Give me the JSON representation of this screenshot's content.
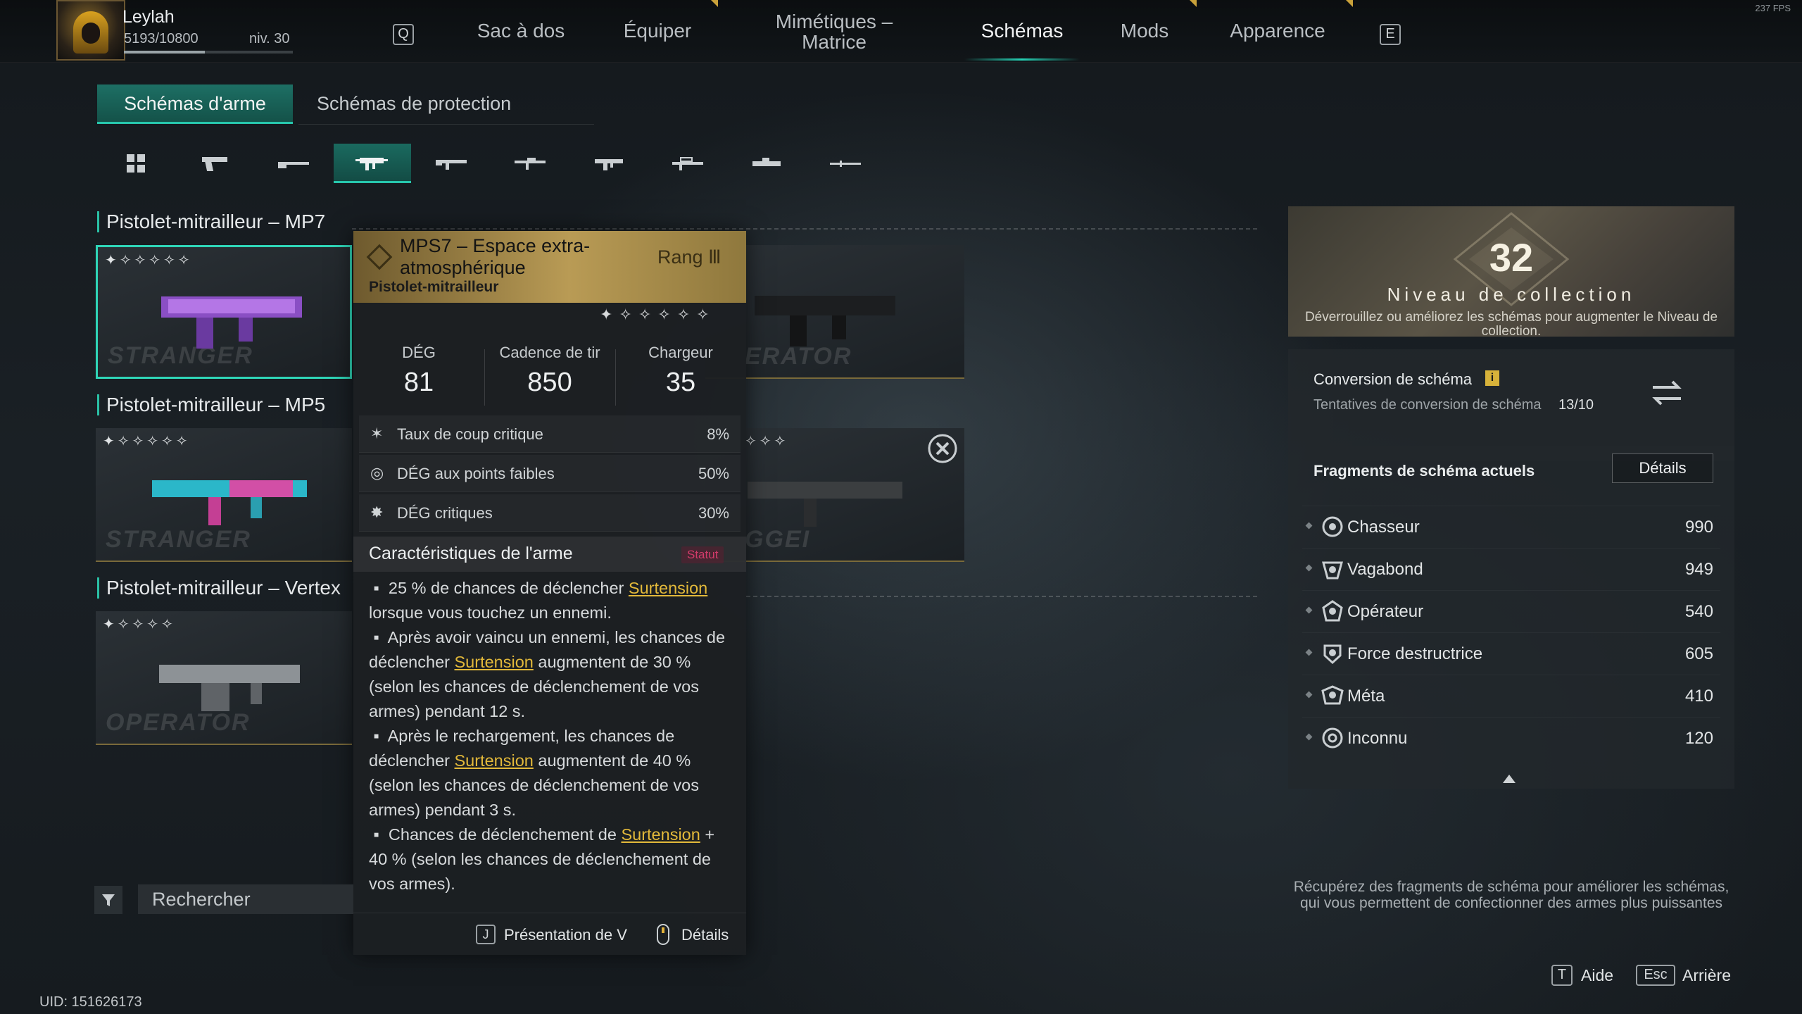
{
  "fps": "237 FPS",
  "player": {
    "name": "Leylah",
    "xp": "5193/10800",
    "xp_fraction": 0.48,
    "level": "niv. 30"
  },
  "nav": {
    "key_left": "Q",
    "key_right": "E",
    "tabs": [
      "Sac à dos",
      "Équiper",
      "Mimétiques –\nMatrice",
      "Schémas",
      "Mods",
      "Apparence"
    ],
    "active_tab": "Schémas"
  },
  "subtabs": {
    "weapon": "Schémas d'arme",
    "protection": "Schémas de protection"
  },
  "weapon_types": [
    "all-icon",
    "pistol-icon",
    "shotgun-icon",
    "smg-icon",
    "assault-rifle-icon",
    "battle-rifle-icon",
    "lmg-icon",
    "sniper-icon",
    "crossbow-icon",
    "melee-icon"
  ],
  "sections": [
    {
      "title": "Pistolet-mitrailleur – MP7",
      "cards": [
        {
          "stars": "✦✧✧✧✧✧",
          "label": "STRANGER"
        },
        {
          "stars": "",
          "label": "ERATOR"
        }
      ]
    },
    {
      "title": "Pistolet-mitrailleur – MP5",
      "cards": [
        {
          "stars": "✦✧✧✧✧✧",
          "label": "STRANGER"
        },
        {
          "stars": "✧✧✧",
          "label": "GGEI"
        }
      ]
    },
    {
      "title": "Pistolet-mitrailleur – Vertex",
      "cards": [
        {
          "stars": "✦✧✧✧✧",
          "label": "OPERATOR"
        }
      ]
    }
  ],
  "tooltip": {
    "title": "MPS7 – Espace extra-atmosphérique",
    "type": "Pistolet-mitrailleur",
    "rank": "Rang Ⅲ",
    "stars": "✦✧✧✧✧✧",
    "stats": [
      {
        "label": "DÉG",
        "value": "81"
      },
      {
        "label": "Cadence de tir",
        "value": "850"
      },
      {
        "label": "Chargeur",
        "value": "35"
      }
    ],
    "props": [
      {
        "icon": "crit-rate-icon",
        "name": "Taux de coup critique",
        "value": "8%"
      },
      {
        "icon": "weakspot-icon",
        "name": "DÉG aux points faibles",
        "value": "50%"
      },
      {
        "icon": "crit-damage-icon",
        "name": "DÉG critiques",
        "value": "30%"
      }
    ],
    "features_title": "Caractéristiques de l'arme",
    "features_badge": "Statut",
    "features": [
      {
        "pre": "25 % de chances de déclencher ",
        "link": "Surtension",
        "post": " lorsque vous touchez un ennemi."
      },
      {
        "pre": "Après avoir vaincu un ennemi, les chances de déclencher ",
        "link": "Surtension",
        "post": " augmentent de 30 % (selon les chances de déclenchement de vos armes) pendant 12 s."
      },
      {
        "pre": "Après le rechargement, les chances de déclencher ",
        "link": "Surtension",
        "post": " augmentent de 40 % (selon les chances de déclenchement de vos armes) pendant 3 s."
      },
      {
        "pre": "Chances de déclenchement de ",
        "link": "Surtension",
        "post": " + 40 % (selon les chances de déclenchement de vos armes)."
      }
    ],
    "footer": {
      "key_j": "J",
      "presentation": "Présentation de V",
      "details": "Détails"
    }
  },
  "search": {
    "placeholder": "Rechercher"
  },
  "uid": "UID: 151626173",
  "collection": {
    "level": "32",
    "label": "Niveau de collection",
    "desc": "Déverrouillez ou améliorez les schémas pour augmenter le Niveau de collection."
  },
  "conversion": {
    "title": "Conversion de schéma",
    "info": "i",
    "attempts_label": "Tentatives de conversion de schéma",
    "attempts": "13/10"
  },
  "fragments": {
    "title": "Fragments de schéma actuels",
    "details": "Détails",
    "items": [
      {
        "name": "Chasseur",
        "value": "990"
      },
      {
        "name": "Vagabond",
        "value": "949"
      },
      {
        "name": "Opérateur",
        "value": "540"
      },
      {
        "name": "Force destructrice",
        "value": "605"
      },
      {
        "name": "Méta",
        "value": "410"
      },
      {
        "name": "Inconnu",
        "value": "120"
      }
    ]
  },
  "bottom_tip": "Récupérez des fragments de schéma pour améliorer les schémas, qui vous permettent de confectionner des armes plus puissantes",
  "footer_keys": {
    "help_key": "T",
    "help": "Aide",
    "back_key": "Esc",
    "back": "Arrière"
  }
}
